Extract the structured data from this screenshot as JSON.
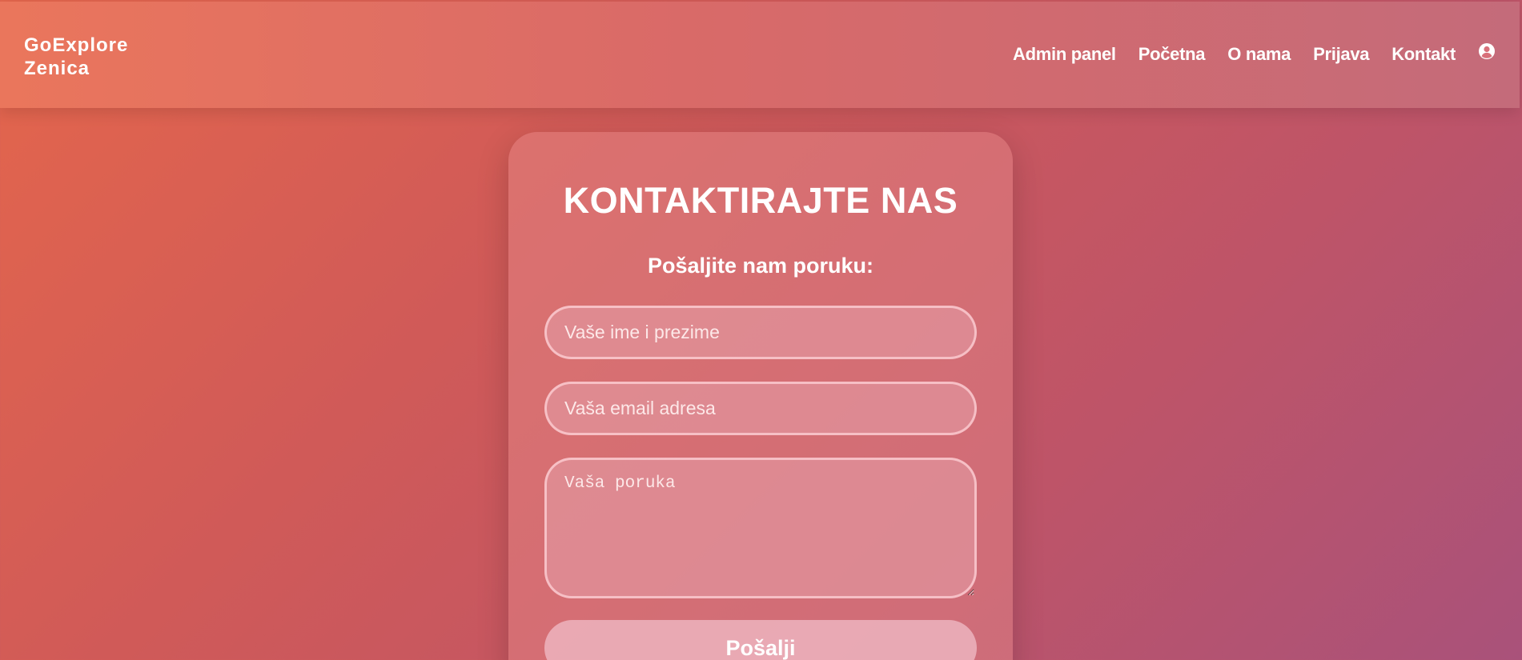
{
  "navbar": {
    "logo_line1": "GoExplore",
    "logo_line2": "Zenica",
    "links": [
      {
        "label": "Admin panel"
      },
      {
        "label": "Početna"
      },
      {
        "label": "O nama"
      },
      {
        "label": "Prijava"
      },
      {
        "label": "Kontakt"
      }
    ],
    "user_icon": "user-circle-icon"
  },
  "contact": {
    "title": "KONTAKTIRAJTE NAS",
    "subtitle": "Pošaljite nam poruku:",
    "name_placeholder": "Vaše ime i prezime",
    "email_placeholder": "Vaša email adresa",
    "message_placeholder": "Vaša poruka",
    "submit_label": "Pošalji"
  },
  "colors": {
    "background_start": "#e4664c",
    "background_end": "#a9527a",
    "navbar_start": "#ea765c",
    "navbar_end": "#c46b7a",
    "text": "#ffffff"
  }
}
